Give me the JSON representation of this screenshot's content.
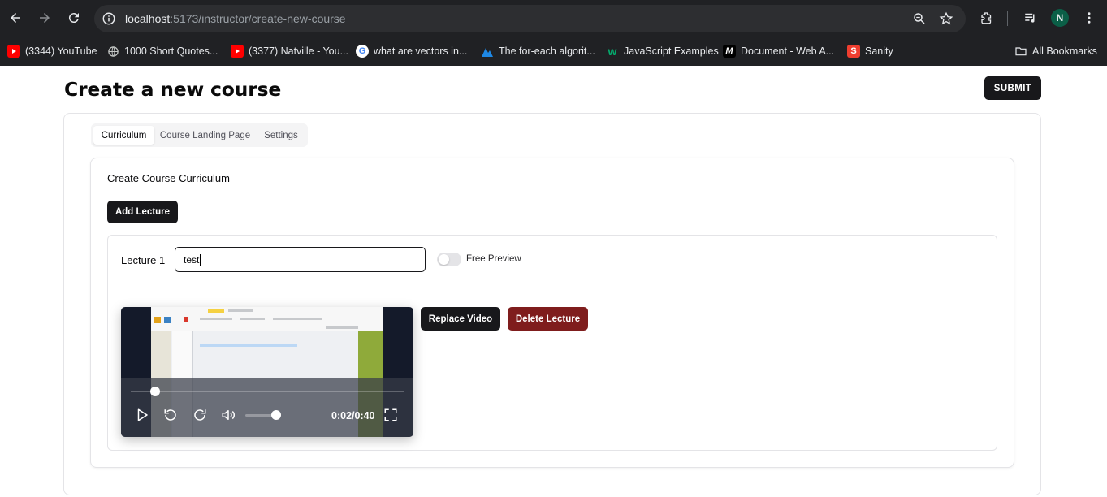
{
  "browser": {
    "url_host": "localhost",
    "url_rest": ":5173/instructor/create-new-course",
    "profile_initial": "N",
    "bookmarks": [
      {
        "label": "(3344) YouTube",
        "icon": "youtube-icon",
        "color": "#ff0000"
      },
      {
        "label": "1000 Short Quotes...",
        "icon": "globe-icon",
        "color": "#9aa0a6"
      },
      {
        "label": "(3377) Natville - You...",
        "icon": "youtube-icon",
        "color": "#ff0000"
      },
      {
        "label": "what are vectors in...",
        "icon": "google-icon",
        "color": "#4285f4"
      },
      {
        "label": "The for-each algorit...",
        "icon": "site-icon",
        "color": "#1e88e5"
      },
      {
        "label": "JavaScript Examples",
        "icon": "w3schools-icon",
        "color": "#04aa6d"
      },
      {
        "label": "Document - Web A...",
        "icon": "mdn-icon",
        "color": "#ffffff"
      },
      {
        "label": "Sanity",
        "icon": "sanity-icon",
        "color": "#f03e2f"
      }
    ],
    "all_bookmarks": "All Bookmarks"
  },
  "page": {
    "title": "Create a new course",
    "submit_label": "SUBMIT"
  },
  "tabs": [
    {
      "label": "Curriculum",
      "active": true
    },
    {
      "label": "Course Landing Page",
      "active": false
    },
    {
      "label": "Settings",
      "active": false
    }
  ],
  "curriculum": {
    "section_title": "Create Course Curriculum",
    "add_lecture_label": "Add Lecture",
    "lecture": {
      "label": "Lecture 1",
      "title_value": "test",
      "free_preview_label": "Free Preview",
      "free_preview_on": false,
      "replace_video_label": "Replace Video",
      "delete_lecture_label": "Delete Lecture",
      "video": {
        "time_display": "0:02/0:40",
        "progress_fraction": 0.05,
        "volume_fraction": 0.8
      }
    }
  },
  "colors": {
    "primary": "#18181b",
    "danger": "#7f1d1d",
    "border": "#e4e4e7"
  }
}
